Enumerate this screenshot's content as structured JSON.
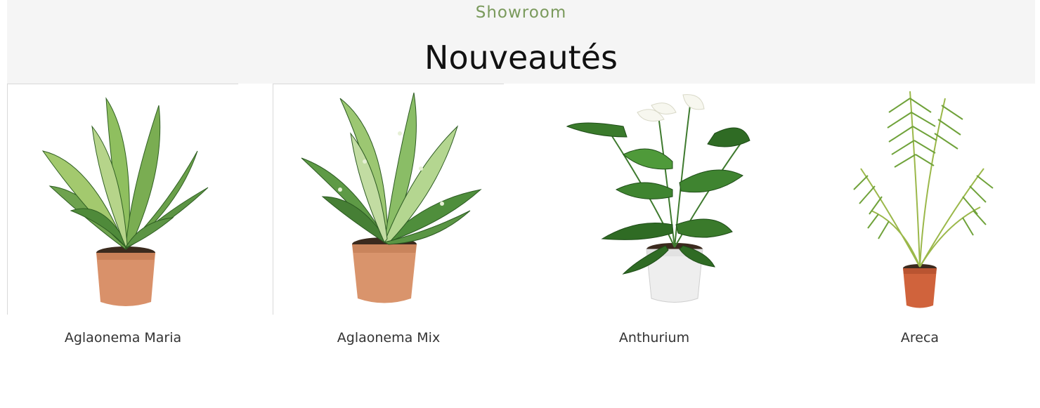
{
  "header": {
    "eyebrow": "Showroom",
    "title": "Nouveautés"
  },
  "colors": {
    "eyebrow": "#7a9a5c",
    "hero_background": "#f5f5f5",
    "title": "#111111",
    "product_name": "#333333"
  },
  "products": [
    {
      "name": "Aglaonema Maria",
      "image": "plant-aglaonema-maria-image"
    },
    {
      "name": "Aglaonema Mix",
      "image": "plant-aglaonema-mix-image"
    },
    {
      "name": "Anthurium",
      "image": "plant-anthurium-image"
    },
    {
      "name": "Areca",
      "image": "plant-areca-image"
    }
  ]
}
